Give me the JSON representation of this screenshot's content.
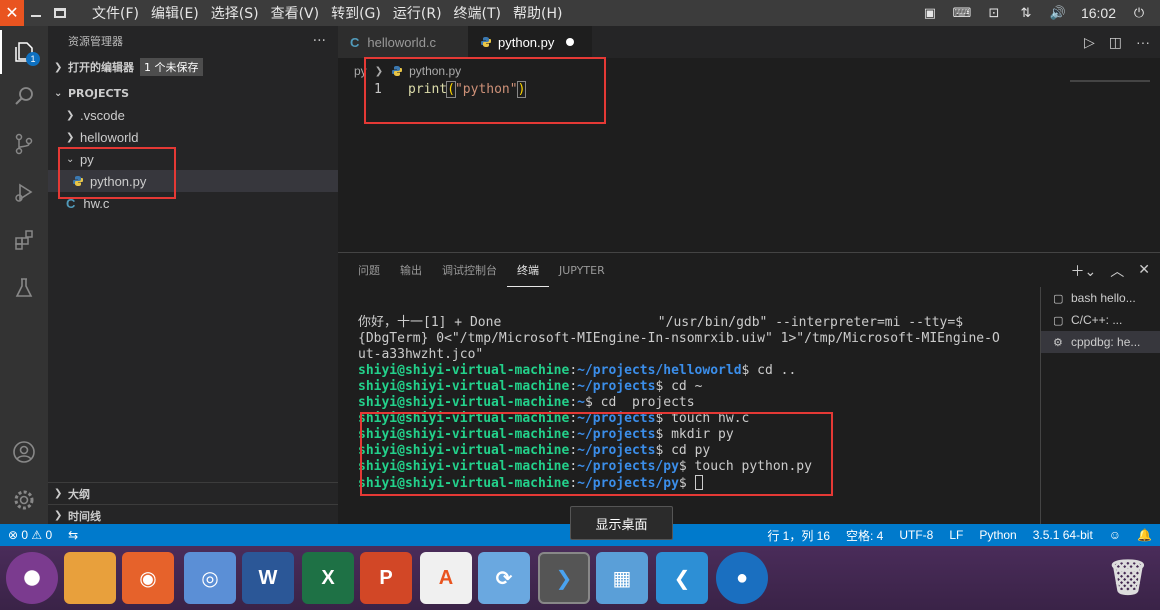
{
  "menubar": {
    "items": [
      "文件(F)",
      "编辑(E)",
      "选择(S)",
      "查看(V)",
      "转到(G)",
      "运行(R)",
      "终端(T)",
      "帮助(H)"
    ],
    "time": "16:02",
    "tray_icons": [
      "remote-icon",
      "keyboard-icon",
      "a11y-icon",
      "network-icon",
      "volume-icon",
      "power-icon"
    ]
  },
  "activity": {
    "explorer_badge": "1"
  },
  "sidebar": {
    "title": "资源管理器",
    "more": "···",
    "open_editors": "打开的编辑器",
    "unsaved": "1 个未保存",
    "projects": "PROJECTS",
    "tree": [
      {
        "label": ".vscode",
        "type": "folder",
        "expanded": false
      },
      {
        "label": "helloworld",
        "type": "folder",
        "expanded": false
      },
      {
        "label": "py",
        "type": "folder",
        "expanded": true
      },
      {
        "label": "python.py",
        "type": "python",
        "selected": true
      },
      {
        "label": "hw.c",
        "type": "c"
      }
    ],
    "outline": "大纲",
    "timeline": "时间线"
  },
  "editor": {
    "tabs": [
      {
        "label": "helloworld.c",
        "active": false
      },
      {
        "label": "python.py",
        "active": true,
        "dirty": true
      }
    ],
    "breadcrumb_prefix": "py",
    "breadcrumb_file": "python.py",
    "line_number": "1",
    "code": {
      "fn": "print",
      "open": "(",
      "str": "\"python\"",
      "close": ")"
    }
  },
  "panel": {
    "tabs": [
      "问题",
      "输出",
      "调试控制台",
      "终端",
      "JUPYTER"
    ],
    "active_tab": "终端",
    "terminal_lines": [
      {
        "type": "plain",
        "text": "你好，十一[1] + Done                    \"/usr/bin/gdb\" --interpreter=mi --tty=$"
      },
      {
        "type": "plain",
        "text": "{DbgTerm} 0<\"/tmp/Microsoft-MIEngine-In-nsomrxib.uiw\" 1>\"/tmp/Microsoft-MIEngine-O"
      },
      {
        "type": "plain",
        "text": "ut-a33hwzht.jco\""
      },
      {
        "type": "prompt",
        "user": "shiyi@shiyi-virtual-machine",
        "path": "~/projects/helloworld",
        "cmd": "$ cd .."
      },
      {
        "type": "prompt",
        "user": "shiyi@shiyi-virtual-machine",
        "path": "~/projects",
        "cmd": "$ cd ~"
      },
      {
        "type": "prompt",
        "user": "shiyi@shiyi-virtual-machine",
        "path": "~",
        "cmd": "$ cd  projects"
      },
      {
        "type": "prompt",
        "user": "shiyi@shiyi-virtual-machine",
        "path": "~/projects",
        "cmd": "$ touch hw.c"
      },
      {
        "type": "prompt",
        "user": "shiyi@shiyi-virtual-machine",
        "path": "~/projects",
        "cmd": "$ mkdir py"
      },
      {
        "type": "prompt",
        "user": "shiyi@shiyi-virtual-machine",
        "path": "~/projects",
        "cmd": "$ cd py"
      },
      {
        "type": "prompt",
        "user": "shiyi@shiyi-virtual-machine",
        "path": "~/projects/py",
        "cmd": "$ touch python.py"
      },
      {
        "type": "prompt",
        "user": "shiyi@shiyi-virtual-machine",
        "path": "~/projects/py",
        "cmd": "$ ",
        "cursor": true
      }
    ],
    "terminal_list": [
      {
        "label": "bash  hello...",
        "icon": "terminal-icon"
      },
      {
        "label": "C/C++: ...",
        "icon": "terminal-icon"
      },
      {
        "label": "cppdbg: he...",
        "icon": "gear-icon",
        "selected": true
      }
    ]
  },
  "statusbar": {
    "problems": "⊗ 0 ⚠ 0",
    "position": "行 1，列 16",
    "spaces": "空格: 4",
    "encoding": "UTF-8",
    "eol": "LF",
    "language": "Python",
    "interpreter": "3.5.1 64-bit"
  },
  "tooltip": "显示桌面",
  "dock": [
    "ubuntu-icon",
    "files-icon",
    "firefox-icon",
    "chromium-icon",
    "writer-icon",
    "calc-icon",
    "impress-icon",
    "software-icon",
    "updater-icon",
    "terminal-icon",
    "show-desktop-icon",
    "vscode-icon",
    "dvd-icon",
    "trash-icon"
  ]
}
